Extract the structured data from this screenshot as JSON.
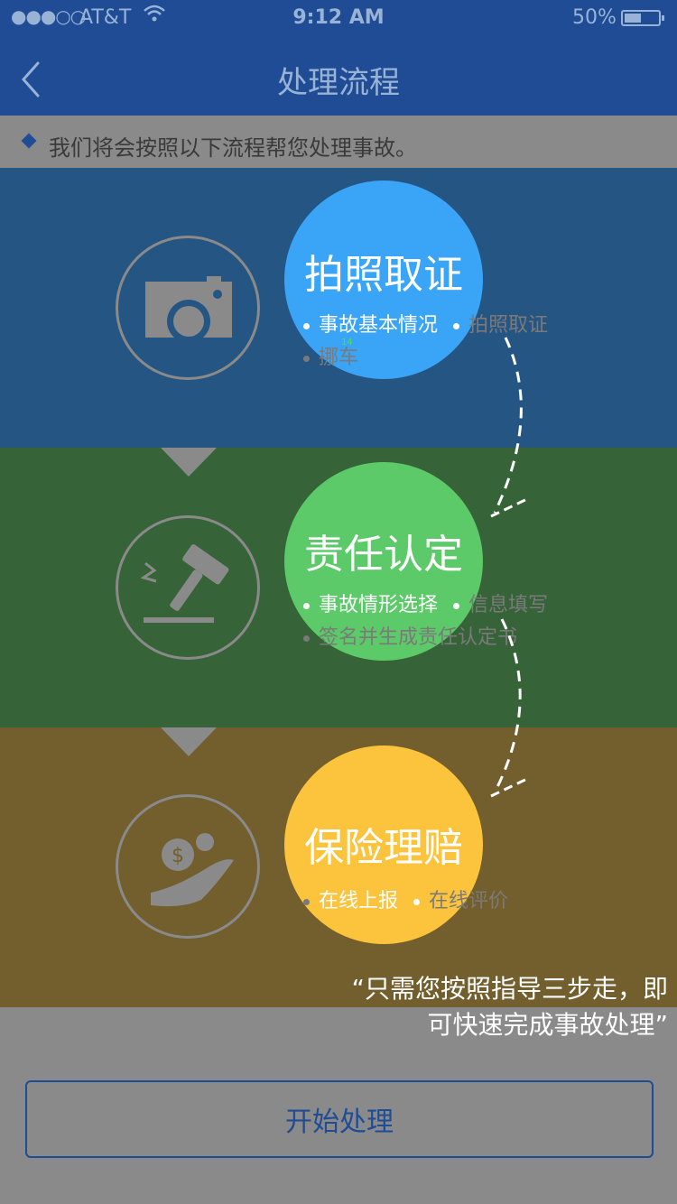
{
  "status_bar": {
    "signal": "●●●○○",
    "carrier": "AT&T",
    "time": "9:12 AM",
    "battery": "50%",
    "battery_level": 0.5
  },
  "nav": {
    "title": "处理流程"
  },
  "notice": "我们将会按照以下流程帮您处理事故。",
  "steps": [
    {
      "title": "拍照取证",
      "icon": "camera-icon",
      "bullets_line1": [
        "事故基本情况",
        "拍照取证"
      ],
      "bullets_line2": [
        "挪车"
      ]
    },
    {
      "title": "责任认定",
      "icon": "gavel-icon",
      "bullets_line1": [
        "事故情形选择",
        "信息填写"
      ],
      "bullets_line2": [
        "签名并生成责任认定书"
      ]
    },
    {
      "title": "保险理赔",
      "icon": "hand-coin-icon",
      "bullets_line1": [
        "在线上报",
        "在线评价"
      ],
      "bullets_line2": []
    }
  ],
  "tiny_label": "14",
  "quote_line1": "“只需您按照指导三步走，即",
  "quote_line2": "可快速完成事故处理”",
  "start_button": "开始处理",
  "colors": {
    "primary": "#1f4c95",
    "step1": "#3aa4f6",
    "step2": "#5cca68",
    "step3": "#fcc33c"
  }
}
